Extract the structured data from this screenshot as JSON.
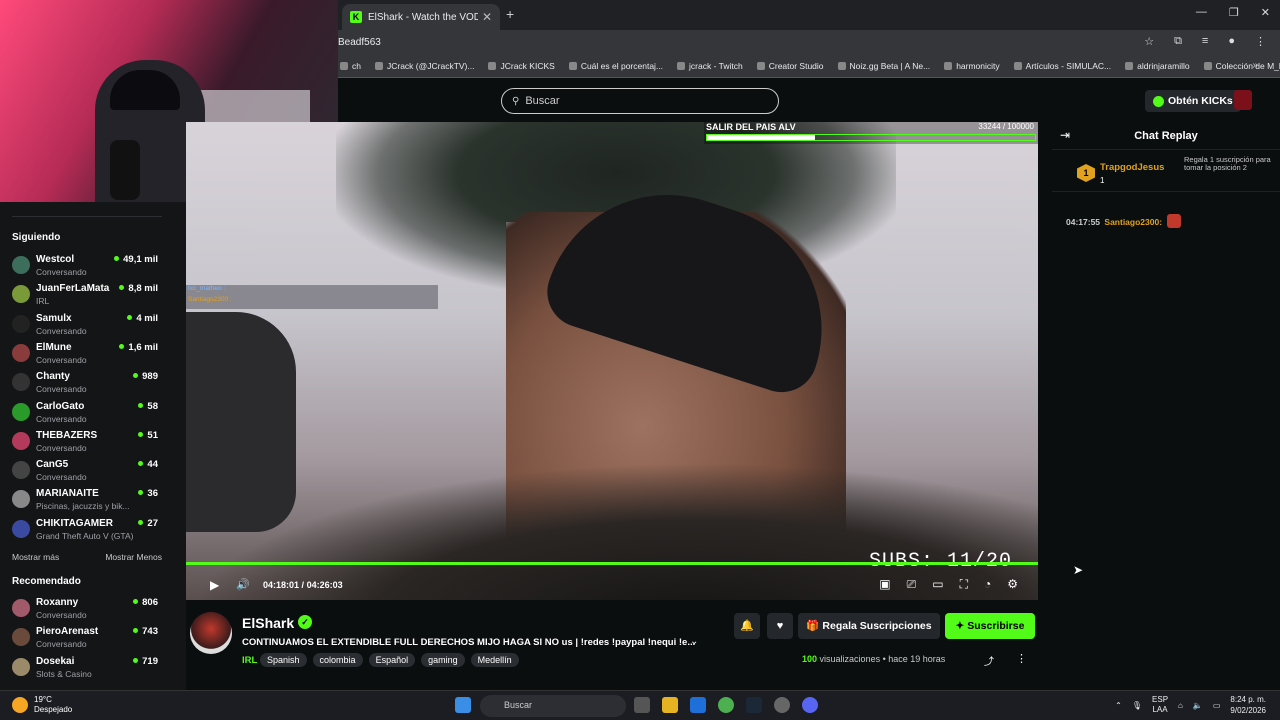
{
  "browser": {
    "tab_title": "ElShark - Watch the VOD on Ki",
    "url": "Beadf563",
    "bookmarks": [
      "ch",
      "JCrack (@JCrackTV)...",
      "JCrack KICKS",
      "Cuál es el porcentaj...",
      "jcrack - Twitch",
      "Creator Studio",
      "Noiz.gg Beta | A Ne...",
      "harmonicity",
      "Artículos - SIMULAC...",
      "aldrinjaramillo",
      "Colección de M_blei..."
    ]
  },
  "topbar": {
    "search_placeholder": "Buscar",
    "kicks_label": "Obtén KICKs"
  },
  "sidebar": {
    "following_title": "Siguiendo",
    "following": [
      {
        "name": "Westcol",
        "sub": "Conversando",
        "viewers": "49,1 mil",
        "color": "#3d6e5b"
      },
      {
        "name": "JuanFerLaMata",
        "sub": "IRL",
        "viewers": "8,8 mil",
        "color": "#7a9a3a"
      },
      {
        "name": "Samulx",
        "sub": "Conversando",
        "viewers": "4 mil",
        "color": "#222"
      },
      {
        "name": "ElMune",
        "sub": "Conversando",
        "viewers": "1,6 mil",
        "color": "#8a3b3b"
      },
      {
        "name": "Chanty",
        "sub": "Conversando",
        "viewers": "989",
        "color": "#333"
      },
      {
        "name": "CarloGato",
        "sub": "Conversando",
        "viewers": "58",
        "color": "#2a9a2a"
      },
      {
        "name": "THEBAZERS",
        "sub": "Conversando",
        "viewers": "51",
        "color": "#b33a5a"
      },
      {
        "name": "CanG5",
        "sub": "Conversando",
        "viewers": "44",
        "color": "#444"
      },
      {
        "name": "MARIANAITE",
        "sub": "Piscinas, jacuzzis y bik...",
        "viewers": "36",
        "color": "#888"
      },
      {
        "name": "CHIKITAGAMER",
        "sub": "Grand Theft Auto V (GTA)",
        "viewers": "27",
        "color": "#3a4aa0"
      }
    ],
    "show_more": "Mostrar más",
    "show_less": "Mostrar Menos",
    "recommended_title": "Recomendado",
    "recommended": [
      {
        "name": "Roxanny",
        "sub": "Conversando",
        "viewers": "806",
        "color": "#a05a6a"
      },
      {
        "name": "PieroArenast",
        "sub": "Conversando",
        "viewers": "743",
        "color": "#6a4a3a"
      },
      {
        "name": "Dosekai",
        "sub": "Slots & Casino",
        "viewers": "719",
        "color": "#9a8a6a"
      }
    ]
  },
  "video": {
    "overlay_goal": "SALIR DEL PAIS ALV",
    "overlay_count": "33244 / 100000",
    "overlay_goal_progress": 0.33,
    "overlay_chat": [
      {
        "user": "txc_matheo :",
        "color": "#7db7ff"
      },
      {
        "user": "Santiago2300 :",
        "color": "#e0a21f"
      }
    ],
    "subs_text": "SUBS: 11/20",
    "time_current": "04:18:01",
    "time_total": "04:26:03",
    "time_sep": "/"
  },
  "chat": {
    "title": "Chat Replay",
    "gift_badge": "1",
    "gift_user": "TrapgodJesus",
    "gift_count": "1",
    "gift_msg": "Regala 1 suscripción para tomar la posición 2",
    "messages": [
      {
        "time": "04:17:55",
        "user": "Santiago2300:"
      }
    ]
  },
  "stream": {
    "name": "ElShark",
    "title": "CONTINUAMOS EL EXTENDIBLE FULL DERECHOS MIJO HAGA SI NO us | !redes !paypal !nequi !e...",
    "category": "IRL",
    "tags": [
      "Spanish",
      "colombia",
      "Español",
      "gaming",
      "Medellín"
    ],
    "gift_label": "Regala Suscripciones",
    "subscribe_label": "Suscribirse",
    "views_count": "100",
    "views_label": "visualizaciones",
    "ago": "hace 19 horas"
  },
  "taskbar": {
    "temp": "19°C",
    "weather": "Despejado",
    "search": "Buscar",
    "lang1": "ESP",
    "lang2": "LAA",
    "time": "8:24 p. m.",
    "date": "9/02/2026"
  }
}
